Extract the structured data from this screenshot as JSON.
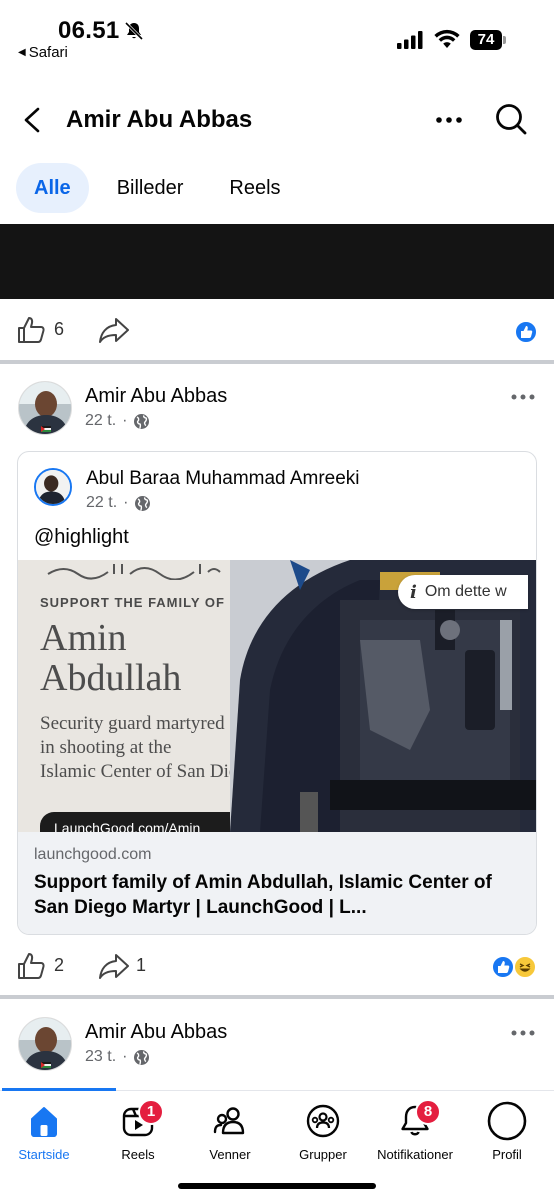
{
  "status_bar": {
    "time": "06.51",
    "back_app": "Safari",
    "battery": "74"
  },
  "header": {
    "title": "Amir Abu Abbas"
  },
  "tabs": [
    {
      "label": "Alle",
      "active": true
    },
    {
      "label": "Billeder",
      "active": false
    },
    {
      "label": "Reels",
      "active": false
    }
  ],
  "first_post": {
    "like_count": "6"
  },
  "post": {
    "author": "Amir Abu Abbas",
    "time": "22 t.",
    "meta_dot": "·",
    "shared": {
      "author": "Abul Baraa Muhammad Amreeki",
      "time": "22 t.",
      "meta_dot": "·",
      "text": "@highlight",
      "image": {
        "support_line": "SUPPORT THE FAMILY OF",
        "name_line1": "Amin",
        "name_line2": "Abdullah",
        "sub_line1": "Security guard martyred",
        "sub_line2": "in shooting at the",
        "sub_line3": "Islamic Center of San Diego",
        "url_pill": "LaunchGood.com/Amin",
        "info_label": "Om dette w"
      },
      "link_domain": "launchgood.com",
      "link_title": "Support family of Amin Abdullah, Islamic Center of San Diego Martyr | LaunchGood | L..."
    },
    "like_count": "2",
    "share_count": "1"
  },
  "next_post": {
    "author": "Amir Abu Abbas",
    "time": "23 t.",
    "meta_dot": "·"
  },
  "bottom_nav": [
    {
      "label": "Startside",
      "icon": "home-icon",
      "active": true,
      "badge": ""
    },
    {
      "label": "Reels",
      "icon": "reels-icon",
      "active": false,
      "badge": "1"
    },
    {
      "label": "Venner",
      "icon": "friends-icon",
      "active": false,
      "badge": ""
    },
    {
      "label": "Grupper",
      "icon": "groups-icon",
      "active": false,
      "badge": ""
    },
    {
      "label": "Notifikationer",
      "icon": "bell-icon",
      "active": false,
      "badge": "8"
    },
    {
      "label": "Profil",
      "icon": "profile-icon",
      "active": false,
      "badge": ""
    }
  ],
  "colors": {
    "accent": "#1877f2",
    "badge": "#e41e3f",
    "tab_active_bg": "#e7f0fd"
  }
}
